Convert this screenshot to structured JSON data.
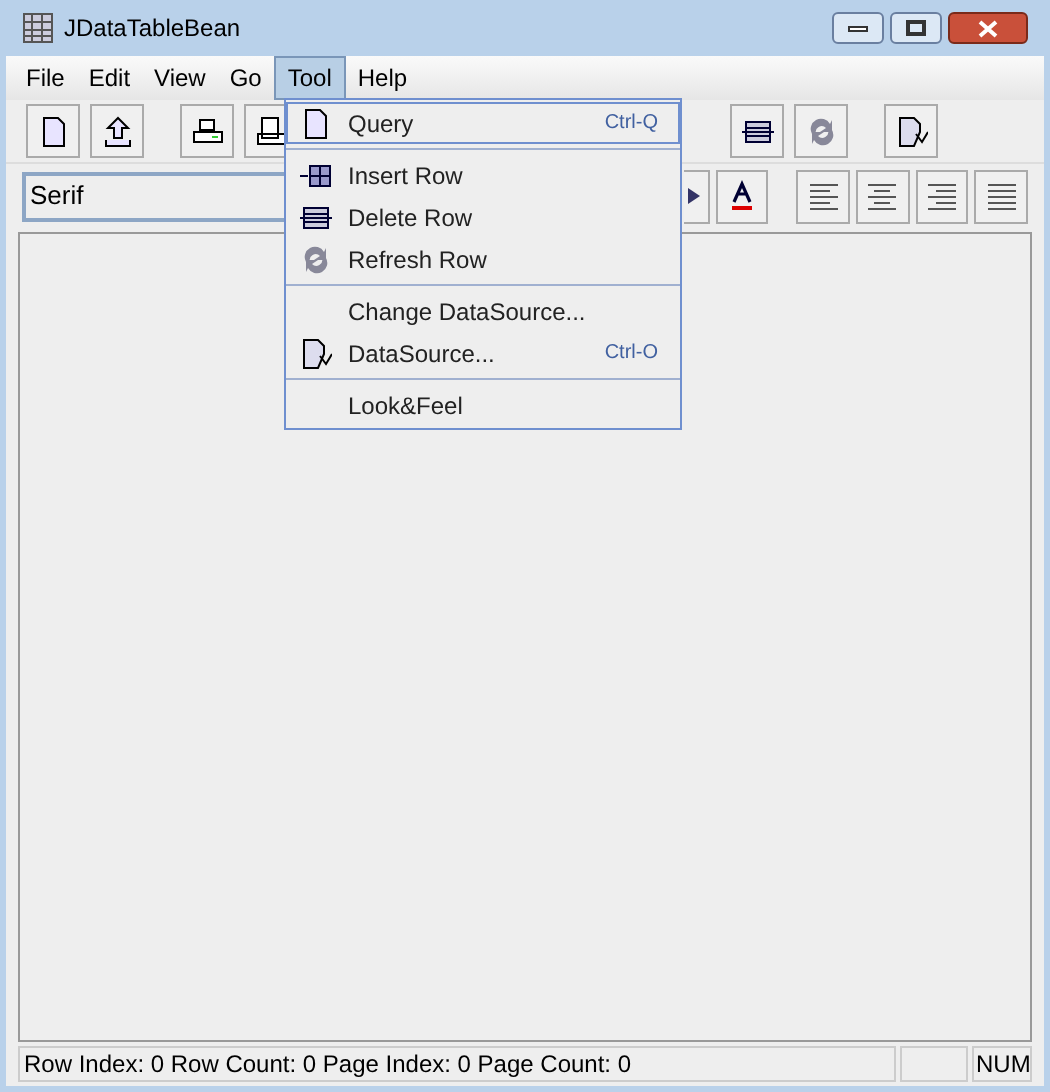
{
  "window": {
    "title": "JDataTableBean"
  },
  "menu_bar": [
    {
      "label": "File",
      "selected": false
    },
    {
      "label": "Edit",
      "selected": false
    },
    {
      "label": "View",
      "selected": false
    },
    {
      "label": "Go",
      "selected": false
    },
    {
      "label": "Tool",
      "selected": true
    },
    {
      "label": "Help",
      "selected": false
    }
  ],
  "toolbar_1": [
    {
      "kind": "page"
    },
    {
      "kind": "upload"
    },
    {
      "kind": "gap"
    },
    {
      "kind": "printer"
    },
    {
      "kind": "print-preview"
    },
    {
      "kind": "hidden"
    },
    {
      "kind": "delete-row"
    },
    {
      "kind": "refresh"
    },
    {
      "kind": "gap"
    },
    {
      "kind": "datasource"
    }
  ],
  "toolbar_2": {
    "font": {
      "value": "Serif"
    },
    "buttons": [
      {
        "kind": "partial"
      },
      {
        "kind": "font-color"
      },
      {
        "kind": "gap"
      },
      {
        "kind": "align-left"
      },
      {
        "kind": "align-center"
      },
      {
        "kind": "align-right"
      },
      {
        "kind": "justify"
      }
    ]
  },
  "tool_menu": [
    {
      "kind": "page",
      "label": "Query",
      "shortcut": "Ctrl-Q",
      "selected": true
    },
    {
      "kind": "separator"
    },
    {
      "kind": "insert-row",
      "label": "Insert Row",
      "selected": false
    },
    {
      "kind": "delete-row",
      "label": "Delete Row",
      "selected": false
    },
    {
      "kind": "refresh",
      "label": "Refresh Row",
      "selected": false
    },
    {
      "kind": "separator"
    },
    {
      "kind": "plain",
      "label": "Change DataSource...",
      "selected": false
    },
    {
      "kind": "datasource",
      "label": "DataSource...",
      "shortcut": "Ctrl-O",
      "selected": false
    },
    {
      "kind": "separator"
    },
    {
      "kind": "plain",
      "label": "Look&Feel",
      "selected": false
    }
  ],
  "status_bar": {
    "text": "Row Index: 0 Row Count: 0 Page Index: 0 Page Count: 0",
    "indicator": "NUM"
  }
}
